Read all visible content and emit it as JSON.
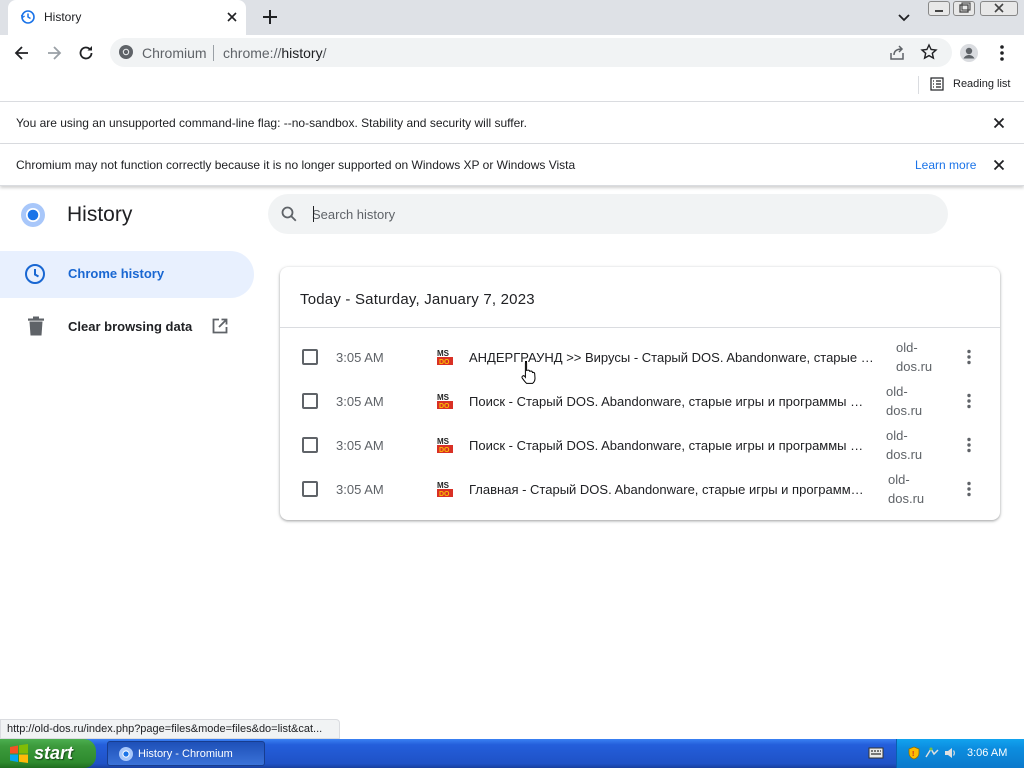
{
  "browser": {
    "tab_title": "History",
    "omnibox": {
      "site": "Chromium",
      "url_prefix": "chrome://",
      "url_path": "history",
      "url_suffix": "/"
    },
    "reading_list_label": "Reading list"
  },
  "infobars": [
    {
      "message": "You are using an unsupported command-line flag: --no-sandbox. Stability and security will suffer.",
      "link": ""
    },
    {
      "message": "Chromium may not function correctly because it is no longer supported on Windows XP or Windows Vista",
      "link": "Learn more"
    }
  ],
  "page": {
    "title": "History",
    "search_placeholder": "Search history",
    "nav": {
      "chrome_history": "Chrome history",
      "clear_browsing_data": "Clear browsing data"
    },
    "day_header": "Today - Saturday, January 7, 2023",
    "entries": [
      {
        "time": "3:05 AM",
        "title": "АНДЕРГРАУНД >> Вирусы - Старый DOS. Abandonware, старые игры и программы",
        "domain_line1": "old-",
        "domain_line2": "dos.ru"
      },
      {
        "time": "3:05 AM",
        "title": "Поиск - Старый DOS. Abandonware, старые игры и программы - DOS",
        "domain_line1": "old-",
        "domain_line2": "dos.ru"
      },
      {
        "time": "3:05 AM",
        "title": "Поиск - Старый DOS. Abandonware, старые игры и программы - DOS",
        "domain_line1": "old-",
        "domain_line2": "dos.ru"
      },
      {
        "time": "3:05 AM",
        "title": "Главная - Старый DOS. Abandonware, старые игры и программы для DOS",
        "domain_line1": "old-",
        "domain_line2": "dos.ru"
      }
    ]
  },
  "status_bar": "http://old-dos.ru/index.php?page=files&mode=files&do=list&cat...",
  "taskbar": {
    "start_label": "start",
    "task_label": "History - Chromium",
    "clock": "3:06 AM"
  },
  "colors": {
    "accent": "#1a73e8",
    "nav_selected_bg": "#e8f0fe",
    "nav_selected_text": "#1967d2",
    "taskbar": "#245edb",
    "start": "#3c9a3c"
  }
}
